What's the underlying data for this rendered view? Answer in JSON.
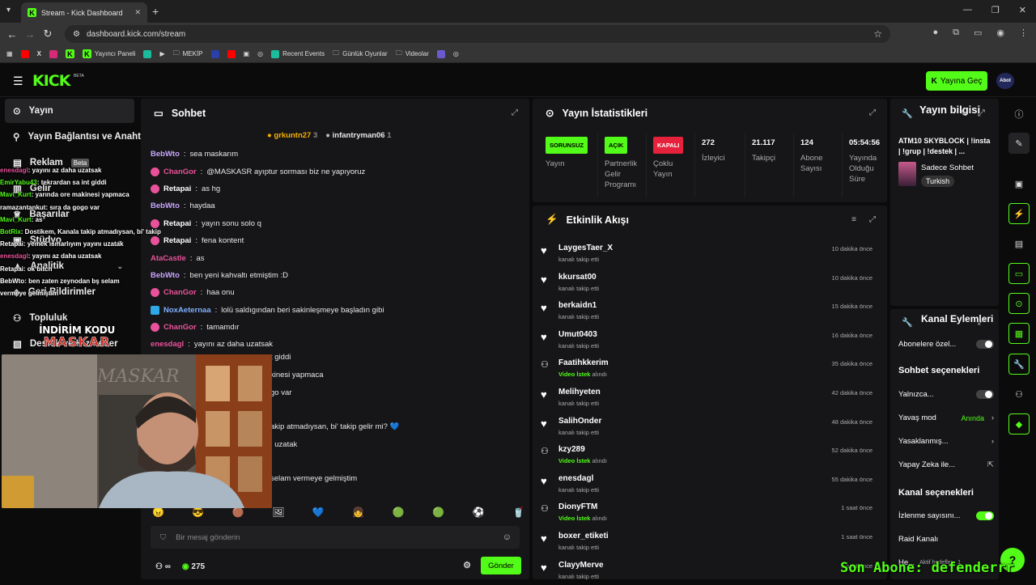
{
  "browser": {
    "tab_title": "Stream - Kick Dashboard",
    "url": "dashboard.kick.com/stream",
    "bookmarks": [
      "Yayıncı Paneli",
      "MEKİP",
      "Recent Events",
      "Günlük Oyunlar",
      "Videolar"
    ]
  },
  "header": {
    "logo": "KICK",
    "beta": "BETA",
    "go_live": "Yayına Geç",
    "avatar": "Abot"
  },
  "sidebar": {
    "items": [
      {
        "label": "Yayın"
      },
      {
        "label": "Yayın Bağlantısı ve Anahtarı"
      },
      {
        "label": "Reklam",
        "badge": "Beta"
      },
      {
        "label": "Gelir"
      },
      {
        "label": "Başarılar"
      },
      {
        "label": "Stüdyo"
      },
      {
        "label": "Analitik"
      },
      {
        "label": "Geri Bildirimler"
      },
      {
        "label": "Topluluk"
      },
      {
        "label": "Destek ve Hizmetler"
      }
    ]
  },
  "overlay_chat": [
    {
      "user": "enesdagl",
      "text": ": yayını az daha uzatsak",
      "color": "#e9529a"
    },
    {
      "user": "EmirYabu43",
      "text": ": tekrardan sa int giddi",
      "color": "#53fc18"
    },
    {
      "user": "Mavi_Kurt",
      "text": ": yarında ore makinesi yapmaca",
      "color": "#53fc18"
    },
    {
      "user": "ramazantankut",
      "text": ": sıra da gogo var",
      "color": "#ffffff"
    },
    {
      "user": "Mavi_Kurt",
      "text": ": as",
      "color": "#53fc18"
    },
    {
      "user": "BotRix",
      "text": ": Dostikem, Kanala takip atmadıysan, bi' takip gelir mi? 💙",
      "color": "#53fc18"
    },
    {
      "user": "Retapai",
      "text": ": yemek ısmarlıyım yayını uzatak",
      "color": "#ffffff"
    },
    {
      "user": "enesdagl",
      "text": ": yayını az daha uzatsak",
      "color": "#e9529a"
    },
    {
      "user": "Retapai",
      "text": ": ok bitch",
      "color": "#ffffff"
    },
    {
      "user": "BebWto",
      "text": ": ben zaten zeynodan bş selam",
      "color": "#ffffff"
    },
    {
      "user": "",
      "text": "vermeye gelmiştim",
      "color": "#ffffff"
    }
  ],
  "promo": {
    "line1": "İNDİRİM KODU",
    "line2": "MASKAR"
  },
  "chat": {
    "title": "Sohbet",
    "pinned": [
      {
        "user": "grkuntn27",
        "count": "3"
      },
      {
        "user": "infantryman06",
        "count": "1"
      }
    ],
    "messages": [
      {
        "user": "BebWto",
        "text": "sea maskarım",
        "color": "#c9a6ff",
        "badge": false
      },
      {
        "user": "ChanGor",
        "text": "@MASKASR ayıptur sorması biz ne yapıyoruz",
        "color": "#e9529a",
        "badge": true
      },
      {
        "user": "Retapai",
        "text": "as hg",
        "color": "#ffffff",
        "badge": true
      },
      {
        "user": "BebWto",
        "text": "haydaa",
        "color": "#c9a6ff",
        "badge": false
      },
      {
        "user": "Retapai",
        "text": "yayın sonu solo q",
        "color": "#ffffff",
        "badge": true
      },
      {
        "user": "Retapai",
        "text": "fena kontent",
        "color": "#ffffff",
        "badge": true
      },
      {
        "user": "AtaCastle",
        "text": "as",
        "color": "#e9529a",
        "badge": false
      },
      {
        "user": "BebWto",
        "text": "ben yeni kahvaltı etmiştim :D",
        "color": "#c9a6ff",
        "badge": false
      },
      {
        "user": "ChanGor",
        "text": "haa onu",
        "color": "#e9529a",
        "badge": true
      },
      {
        "user": "NoxAeternaa",
        "text": "lolü saldıgından beri sakinleşmeye başladın gibi",
        "color": "#7fb0ff",
        "badge": "sq"
      },
      {
        "user": "ChanGor",
        "text": "tamamdır",
        "color": "#e9529a",
        "badge": true
      },
      {
        "user": "enesdagl",
        "text": "yayını az daha uzatsak",
        "color": "#e9529a",
        "badge": false
      }
    ],
    "hidden_tail": [
      "t giddi",
      "kinesi yapmaca",
      "go var",
      "akip atmadıysan, bi' takip gelir mi? 💙",
      "ı uzatak",
      "selam vermeye gelmiştim"
    ],
    "emotes": [
      "😠",
      "😎",
      "🟤",
      "🖼",
      "💙",
      "👧",
      "🟢",
      "🟢",
      "⚽",
      "🥤"
    ],
    "input_placeholder": "Bir mesaj gönderin",
    "footer": {
      "infinity": "∞",
      "points": "275",
      "send": "Gönder"
    }
  },
  "stats": {
    "title": "Yayın İstatistikleri",
    "items": [
      {
        "pill": "SORUNSUZ",
        "pill_bg": "#53fc18",
        "pill_fg": "#000000",
        "label": "Yayın"
      },
      {
        "pill": "AÇIK",
        "pill_bg": "#53fc18",
        "pill_fg": "#000000",
        "label": "Partnerlik Gelir Programı"
      },
      {
        "pill": "KAPALI",
        "pill_bg": "#e5213c",
        "pill_fg": "#ffffff",
        "label": "Çoklu Yayın"
      },
      {
        "value": "272",
        "label": "İzleyici"
      },
      {
        "value": "21.117",
        "label": "Takipçi"
      },
      {
        "value": "124",
        "label": "Abone Sayısı"
      },
      {
        "value": "05:54:56",
        "label": "Yayında Olduğu Süre"
      }
    ]
  },
  "activity": {
    "title": "Etkinlik Akışı",
    "events": [
      {
        "user": "LaygesTaer_X",
        "sub": "kanalı takip etti",
        "time": "10 dakika önce",
        "type": "follow"
      },
      {
        "user": "kkursat00",
        "sub": "kanalı takip etti",
        "time": "10 dakika önce",
        "type": "follow"
      },
      {
        "user": "berkaidn1",
        "sub": "kanalı takip etti",
        "time": "15 dakika önce",
        "type": "follow"
      },
      {
        "user": "Umut0403",
        "sub": "kanalı takip etti",
        "time": "16 dakika önce",
        "type": "follow"
      },
      {
        "user": "Faatihkkerim",
        "sub_hl": "Video İstek",
        "sub": " alındı",
        "time": "35 dakika önce",
        "type": "reward"
      },
      {
        "user": "Melihyeten",
        "sub": "kanalı takip etti",
        "time": "42 dakika önce",
        "type": "follow"
      },
      {
        "user": "SalihOnder",
        "sub": "kanalı takip etti",
        "time": "48 dakika önce",
        "type": "follow"
      },
      {
        "user": "kzy289",
        "sub_hl": "Video İstek",
        "sub": " alındı",
        "time": "52 dakika önce",
        "type": "reward"
      },
      {
        "user": "enesdagl",
        "sub": "kanalı takip etti",
        "time": "55 dakika önce",
        "type": "follow"
      },
      {
        "user": "DionyFTM",
        "sub_hl": "Video İstek",
        "sub": " alındı",
        "time": "1 saat önce",
        "type": "reward"
      },
      {
        "user": "boxer_etiketi",
        "sub": "kanalı takip etti",
        "time": "1 saat önce",
        "type": "follow"
      },
      {
        "user": "ClayyMerve",
        "sub": "kanalı takip etti",
        "time": "1 saat önce",
        "type": "follow"
      }
    ]
  },
  "stream_info": {
    "title": "Yayın bilgisi",
    "stream_title": "ATM10 SKYBLOCK | !insta | !grup | !destek | ...",
    "category": "Sadece Sohbet",
    "language": "Turkish"
  },
  "channel_actions": {
    "title": "Kanal Eylemleri",
    "subs_only": "Abonelere özel...",
    "chat_section": "Sohbet seçenekleri",
    "only": "Yalnızca...",
    "slow_mode": "Yavaş mod",
    "slow_mode_value": "Anında",
    "banned": "Yasaklanmış...",
    "ai": "Yapay Zeka ile...",
    "channel_section": "Kanal seçenekleri",
    "view_count": "İzlenme sayısını...",
    "raid": "Raid Kanalı",
    "he": "He...",
    "active_goals": "Aktif hedefler · 1"
  },
  "overlay_sub": "Son Abone: defenderrr"
}
